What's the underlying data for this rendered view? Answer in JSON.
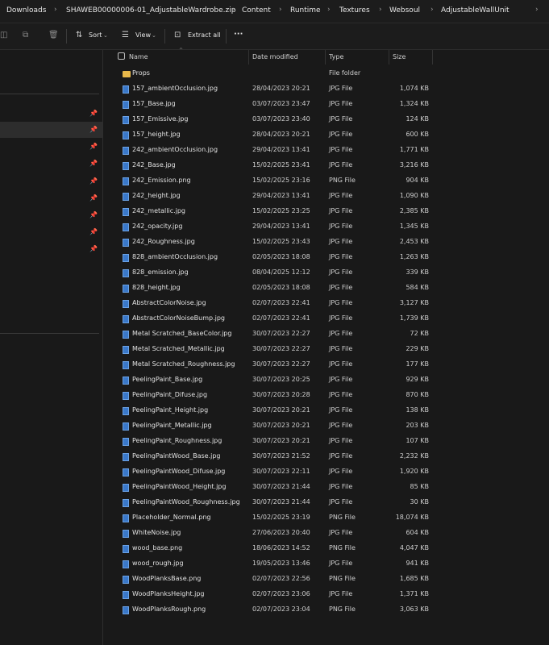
{
  "breadcrumb": {
    "items": [
      "Downloads",
      "SHAWEB00000006-01_AdjustableWardrobe.zip",
      "Content",
      "Runtime",
      "Textures",
      "Websoul",
      "AdjustableWallUnit"
    ],
    "separator": "›"
  },
  "toolbar": {
    "sort_label": "Sort",
    "view_label": "View",
    "extract_label": "Extract all",
    "more_label": "···"
  },
  "columns": {
    "name": "Name",
    "date": "Date modified",
    "type": "Type",
    "size": "Size"
  },
  "files": [
    {
      "name": "Props",
      "date": "",
      "type": "File folder",
      "size": "",
      "kind": "folder"
    },
    {
      "name": "157_ambientOcclusion.jpg",
      "date": "28/04/2023 20:21",
      "type": "JPG File",
      "size": "1,074 KB",
      "kind": "image"
    },
    {
      "name": "157_Base.jpg",
      "date": "03/07/2023 23:47",
      "type": "JPG File",
      "size": "1,324 KB",
      "kind": "image"
    },
    {
      "name": "157_Emissive.jpg",
      "date": "03/07/2023 23:40",
      "type": "JPG File",
      "size": "124 KB",
      "kind": "image"
    },
    {
      "name": "157_height.jpg",
      "date": "28/04/2023 20:21",
      "type": "JPG File",
      "size": "600 KB",
      "kind": "image"
    },
    {
      "name": "242_ambientOcclusion.jpg",
      "date": "29/04/2023 13:41",
      "type": "JPG File",
      "size": "1,771 KB",
      "kind": "image"
    },
    {
      "name": "242_Base.jpg",
      "date": "15/02/2025 23:41",
      "type": "JPG File",
      "size": "3,216 KB",
      "kind": "image"
    },
    {
      "name": "242_Emission.png",
      "date": "15/02/2025 23:16",
      "type": "PNG File",
      "size": "904 KB",
      "kind": "image"
    },
    {
      "name": "242_height.jpg",
      "date": "29/04/2023 13:41",
      "type": "JPG File",
      "size": "1,090 KB",
      "kind": "image"
    },
    {
      "name": "242_metallic.jpg",
      "date": "15/02/2025 23:25",
      "type": "JPG File",
      "size": "2,385 KB",
      "kind": "image"
    },
    {
      "name": "242_opacity.jpg",
      "date": "29/04/2023 13:41",
      "type": "JPG File",
      "size": "1,345 KB",
      "kind": "image"
    },
    {
      "name": "242_Roughness.jpg",
      "date": "15/02/2025 23:43",
      "type": "JPG File",
      "size": "2,453 KB",
      "kind": "image"
    },
    {
      "name": "828_ambientOcclusion.jpg",
      "date": "02/05/2023 18:08",
      "type": "JPG File",
      "size": "1,263 KB",
      "kind": "image"
    },
    {
      "name": "828_emission.jpg",
      "date": "08/04/2025 12:12",
      "type": "JPG File",
      "size": "339 KB",
      "kind": "image"
    },
    {
      "name": "828_height.jpg",
      "date": "02/05/2023 18:08",
      "type": "JPG File",
      "size": "584 KB",
      "kind": "image"
    },
    {
      "name": "AbstractColorNoise.jpg",
      "date": "02/07/2023 22:41",
      "type": "JPG File",
      "size": "3,127 KB",
      "kind": "image"
    },
    {
      "name": "AbstractColorNoiseBump.jpg",
      "date": "02/07/2023 22:41",
      "type": "JPG File",
      "size": "1,739 KB",
      "kind": "image"
    },
    {
      "name": "Metal Scratched_BaseColor.jpg",
      "date": "30/07/2023 22:27",
      "type": "JPG File",
      "size": "72 KB",
      "kind": "image"
    },
    {
      "name": "Metal Scratched_Metallic.jpg",
      "date": "30/07/2023 22:27",
      "type": "JPG File",
      "size": "229 KB",
      "kind": "image"
    },
    {
      "name": "Metal Scratched_Roughness.jpg",
      "date": "30/07/2023 22:27",
      "type": "JPG File",
      "size": "177 KB",
      "kind": "image"
    },
    {
      "name": "PeelingPaint_Base.jpg",
      "date": "30/07/2023 20:25",
      "type": "JPG File",
      "size": "929 KB",
      "kind": "image"
    },
    {
      "name": "PeelingPaint_Difuse.jpg",
      "date": "30/07/2023 20:28",
      "type": "JPG File",
      "size": "870 KB",
      "kind": "image"
    },
    {
      "name": "PeelingPaint_Height.jpg",
      "date": "30/07/2023 20:21",
      "type": "JPG File",
      "size": "138 KB",
      "kind": "image"
    },
    {
      "name": "PeelingPaint_Metallic.jpg",
      "date": "30/07/2023 20:21",
      "type": "JPG File",
      "size": "203 KB",
      "kind": "image"
    },
    {
      "name": "PeelingPaint_Roughness.jpg",
      "date": "30/07/2023 20:21",
      "type": "JPG File",
      "size": "107 KB",
      "kind": "image"
    },
    {
      "name": "PeelingPaintWood_Base.jpg",
      "date": "30/07/2023 21:52",
      "type": "JPG File",
      "size": "2,232 KB",
      "kind": "image"
    },
    {
      "name": "PeelingPaintWood_Difuse.jpg",
      "date": "30/07/2023 22:11",
      "type": "JPG File",
      "size": "1,920 KB",
      "kind": "image"
    },
    {
      "name": "PeelingPaintWood_Height.jpg",
      "date": "30/07/2023 21:44",
      "type": "JPG File",
      "size": "85 KB",
      "kind": "image"
    },
    {
      "name": "PeelingPaintWood_Roughness.jpg",
      "date": "30/07/2023 21:44",
      "type": "JPG File",
      "size": "30 KB",
      "kind": "image"
    },
    {
      "name": "Placeholder_Normal.png",
      "date": "15/02/2025 23:19",
      "type": "PNG File",
      "size": "18,074 KB",
      "kind": "image"
    },
    {
      "name": "WhiteNoise.jpg",
      "date": "27/06/2023 20:40",
      "type": "JPG File",
      "size": "604 KB",
      "kind": "image"
    },
    {
      "name": "wood_base.png",
      "date": "18/06/2023 14:52",
      "type": "PNG File",
      "size": "4,047 KB",
      "kind": "image"
    },
    {
      "name": "wood_rough.jpg",
      "date": "19/05/2023 13:46",
      "type": "JPG File",
      "size": "941 KB",
      "kind": "image"
    },
    {
      "name": "WoodPlanksBase.png",
      "date": "02/07/2023 22:56",
      "type": "PNG File",
      "size": "1,685 KB",
      "kind": "image"
    },
    {
      "name": "WoodPlanksHeight.jpg",
      "date": "02/07/2023 23:06",
      "type": "JPG File",
      "size": "1,371 KB",
      "kind": "image"
    },
    {
      "name": "WoodPlanksRough.png",
      "date": "02/07/2023 23:04",
      "type": "PNG File",
      "size": "3,063 KB",
      "kind": "image"
    }
  ],
  "colors": {
    "background": "#191919",
    "folder": "#e8b84a",
    "image_icon": "#3a78c9"
  }
}
